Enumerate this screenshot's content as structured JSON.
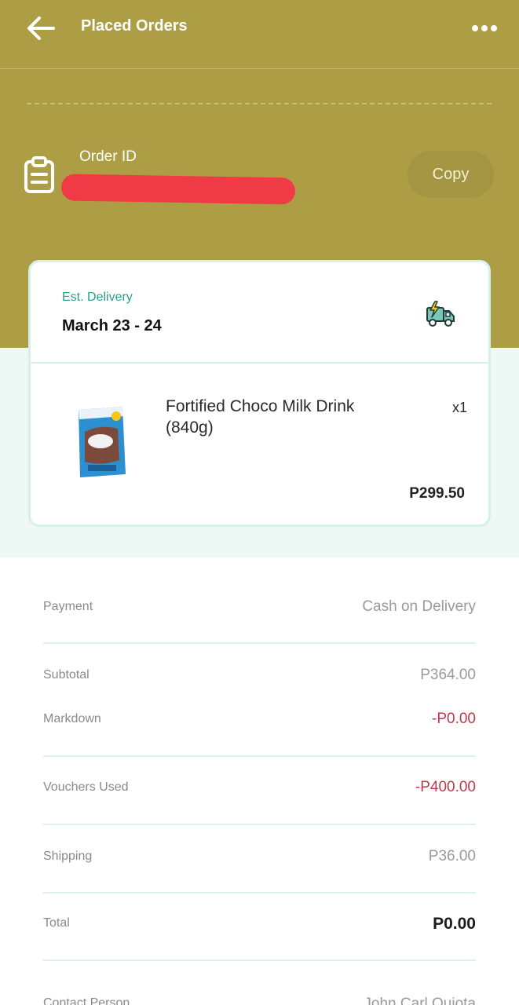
{
  "header": {
    "title": "Placed Orders",
    "back_icon": "arrow-left-icon",
    "menu_icon": "more-horizontal-icon"
  },
  "order": {
    "id_label": "Order ID",
    "copy_label": "Copy"
  },
  "delivery": {
    "label": "Est. Delivery",
    "date": "March 23 - 24"
  },
  "item": {
    "name": "Fortified Choco Milk Drink (840g)",
    "quantity": "x1",
    "price": "P299.50"
  },
  "summary": {
    "payment_label": "Payment",
    "payment_value": "Cash on Delivery",
    "subtotal_label": "Subtotal",
    "subtotal_value": "P364.00",
    "markdown_label": "Markdown",
    "markdown_value": "-P0.00",
    "vouchers_label": "Vouchers Used",
    "vouchers_value": "-P400.00",
    "shipping_label": "Shipping",
    "shipping_value": "P36.00",
    "total_label": "Total",
    "total_value": "P0.00",
    "contact_label": "Contact Person",
    "contact_value": "John Carl Quiota"
  },
  "colors": {
    "header_bg": "#ad9e46",
    "mint_bg": "#eef8f5",
    "accent_teal": "#2a9d8f",
    "negative_red": "#c0394b"
  }
}
